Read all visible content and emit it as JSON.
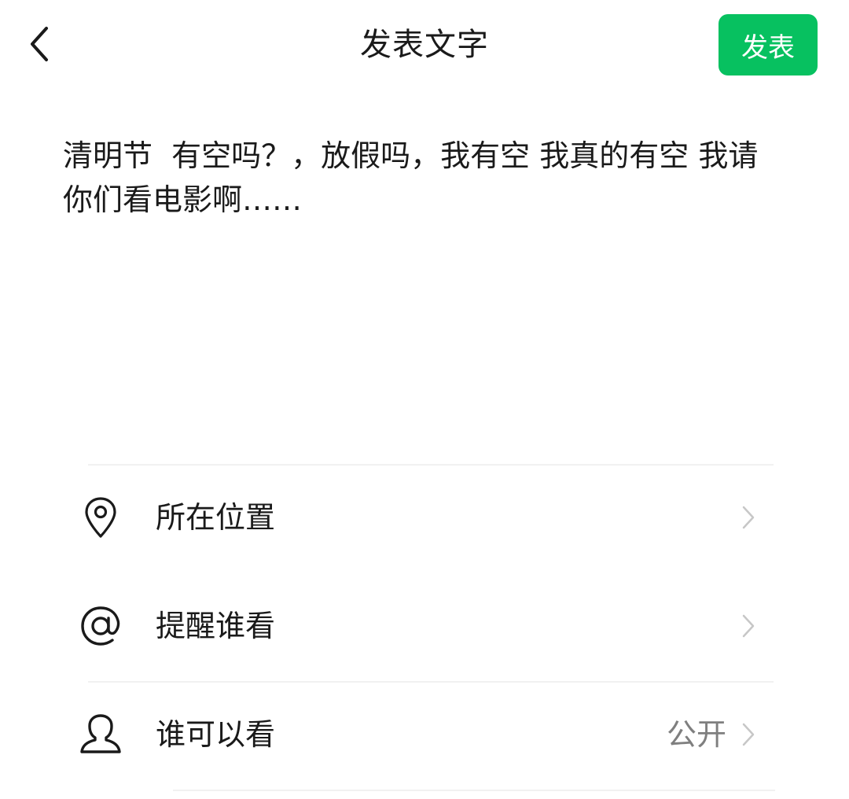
{
  "header": {
    "title": "发表文字",
    "publish_label": "发表",
    "back_icon": "chevron-left-icon"
  },
  "post": {
    "text": "清明节  有空吗？，放假吗，我有空 我真的有空 我请你们看电影啊……"
  },
  "options": [
    {
      "label": "所在位置",
      "icon": "location-pin-icon",
      "value": ""
    },
    {
      "label": "提醒谁看",
      "icon": "at-sign-icon",
      "value": ""
    },
    {
      "label": "谁可以看",
      "icon": "person-icon",
      "value": "公开"
    }
  ],
  "colors": {
    "accent": "#07c160",
    "text_primary": "#1a1a1a",
    "text_secondary": "#7f7f7f",
    "divider": "#f1f1f1",
    "chevron": "#c7c7c7"
  }
}
